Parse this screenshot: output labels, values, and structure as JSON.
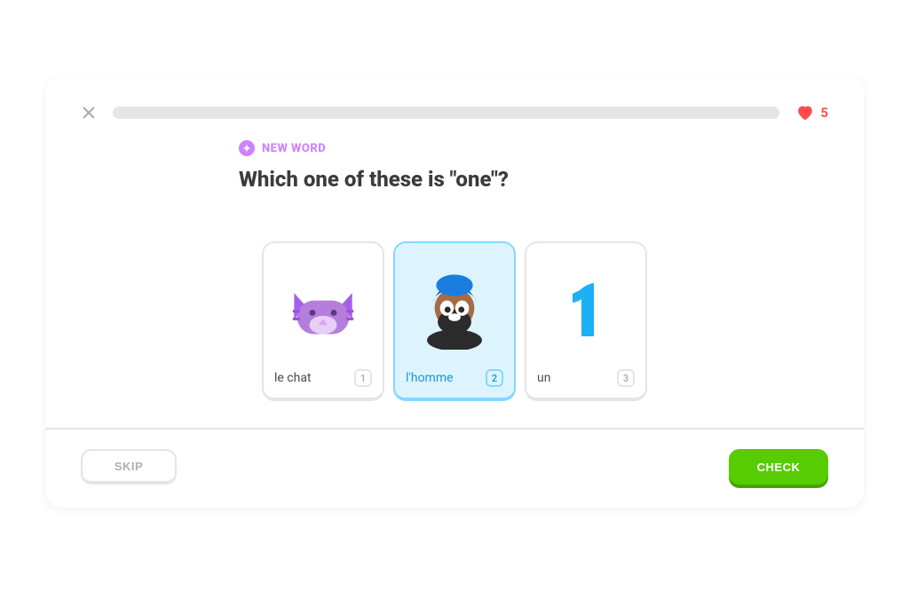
{
  "header": {
    "hearts_count": "5"
  },
  "lesson": {
    "badge_label": "NEW WORD",
    "prompt": "Which one of these is \"one\"?"
  },
  "options": [
    {
      "word": "le chat",
      "key": "1",
      "icon": "cat",
      "selected": false
    },
    {
      "word": "l'homme",
      "key": "2",
      "icon": "man",
      "selected": true
    },
    {
      "word": "un",
      "key": "3",
      "icon": "numeral-one",
      "selected": false
    }
  ],
  "buttons": {
    "skip": "SKIP",
    "check": "CHECK"
  }
}
